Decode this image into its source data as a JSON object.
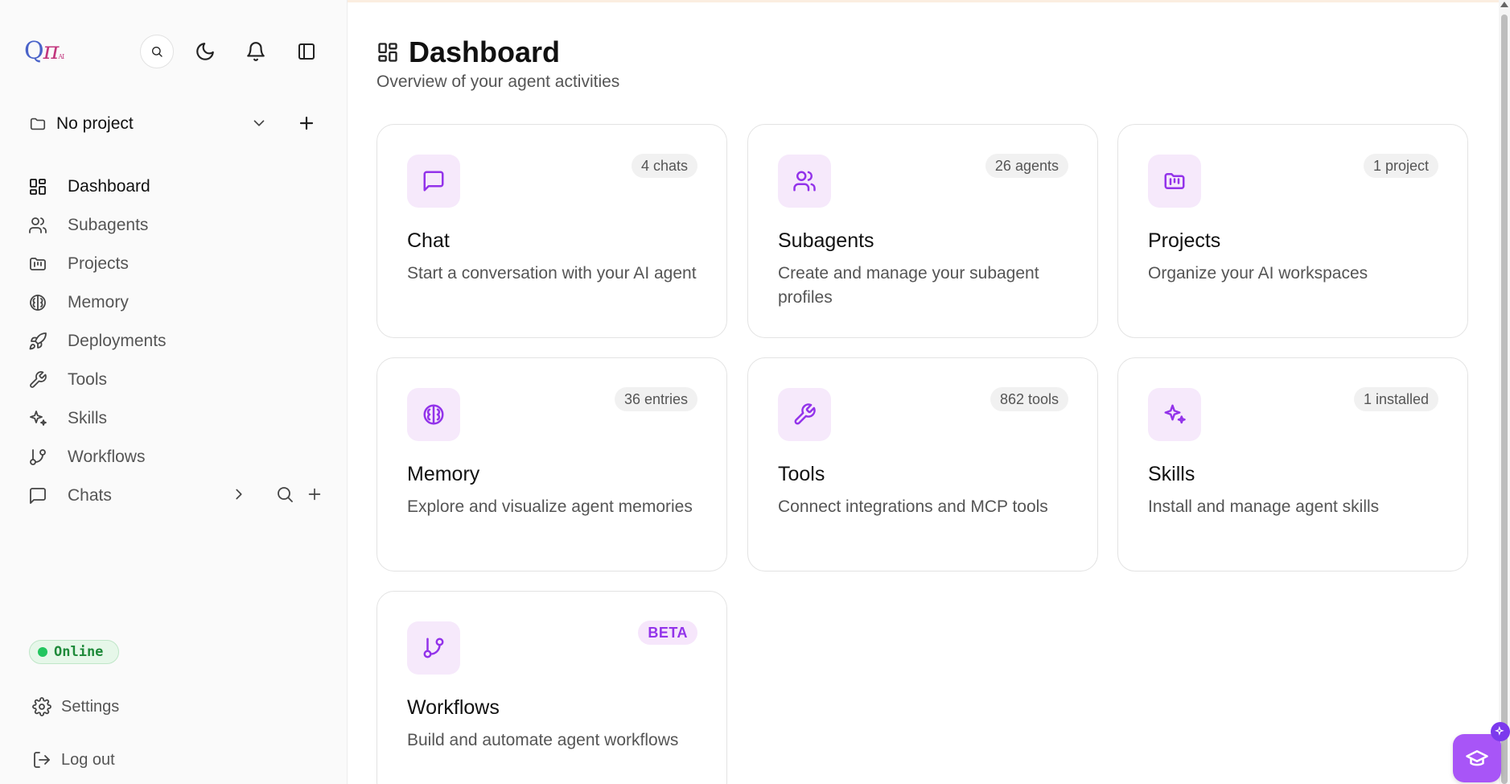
{
  "header": {
    "logo_main": "Q",
    "logo_pi": "π",
    "logo_sub": "AI"
  },
  "project_selector": {
    "label": "No project"
  },
  "sidebar": {
    "items": [
      {
        "label": "Dashboard",
        "icon": "dashboard-icon",
        "active": true
      },
      {
        "label": "Subagents",
        "icon": "users-icon"
      },
      {
        "label": "Projects",
        "icon": "folder-kanban-icon"
      },
      {
        "label": "Memory",
        "icon": "brain-icon"
      },
      {
        "label": "Deployments",
        "icon": "rocket-icon"
      },
      {
        "label": "Tools",
        "icon": "wrench-icon"
      },
      {
        "label": "Skills",
        "icon": "sparkles-icon"
      },
      {
        "label": "Workflows",
        "icon": "git-branch-icon"
      },
      {
        "label": "Chats",
        "icon": "message-square-icon"
      }
    ]
  },
  "status": {
    "label": "Online",
    "color": "#22c55e"
  },
  "footer": {
    "settings_label": "Settings",
    "logout_label": "Log out"
  },
  "main": {
    "title": "Dashboard",
    "subtitle": "Overview of your agent activities",
    "cards": [
      {
        "title": "Chat",
        "description": "Start a conversation with your AI agent",
        "badge": "4 chats",
        "icon": "message-square-icon"
      },
      {
        "title": "Subagents",
        "description": "Create and manage your subagent profiles",
        "badge": "26 agents",
        "icon": "users-icon"
      },
      {
        "title": "Projects",
        "description": "Organize your AI workspaces",
        "badge": "1 project",
        "icon": "folder-kanban-icon"
      },
      {
        "title": "Memory",
        "description": "Explore and visualize agent memories",
        "badge": "36 entries",
        "icon": "brain-icon"
      },
      {
        "title": "Tools",
        "description": "Connect integrations and MCP tools",
        "badge": "862 tools",
        "icon": "wrench-icon"
      },
      {
        "title": "Skills",
        "description": "Install and manage agent skills",
        "badge": "1 installed",
        "icon": "sparkles-icon"
      },
      {
        "title": "Workflows",
        "description": "Build and automate agent workflows",
        "badge": "BETA",
        "icon": "git-branch-icon"
      }
    ]
  },
  "colors": {
    "accent": "#9333ea",
    "accent_bg": "#f6e9fb",
    "fab": "#a855f7"
  }
}
